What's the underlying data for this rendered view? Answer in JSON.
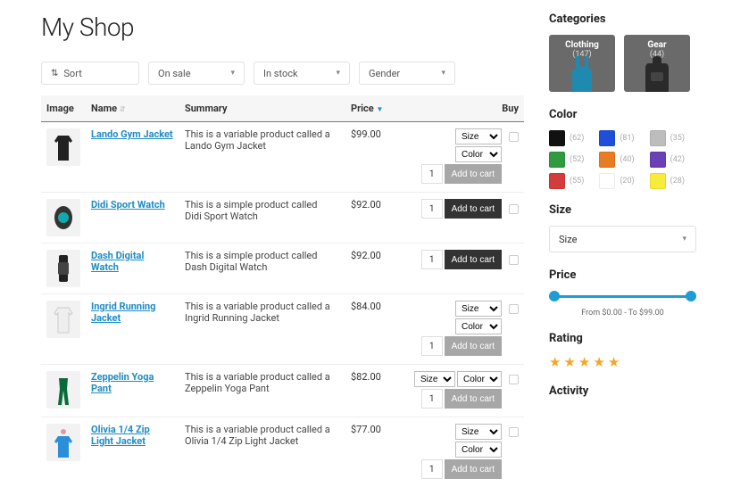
{
  "page": {
    "title": "My Shop"
  },
  "filters": {
    "sort": "Sort",
    "options": [
      "On sale",
      "In stock",
      "Gender"
    ]
  },
  "columns": {
    "image": "Image",
    "name": "Name",
    "summary": "Summary",
    "price": "Price",
    "buy": "Buy"
  },
  "buy": {
    "size": "Size",
    "color": "Color",
    "qty": "1",
    "add": "Add to cart"
  },
  "products": [
    {
      "name": "Lando Gym Jacket",
      "summary": "This is a variable product called a Lando Gym Jacket",
      "price": "$99.00",
      "variable": true,
      "opts": "stack"
    },
    {
      "name": "Didi Sport Watch",
      "summary": "This is a simple product called Didi Sport Watch",
      "price": "$92.00",
      "variable": false
    },
    {
      "name": "Dash Digital Watch",
      "summary": "This is a simple product called Dash Digital Watch",
      "price": "$92.00",
      "variable": false
    },
    {
      "name": "Ingrid Running Jacket",
      "summary": "This is a variable product called a Ingrid Running Jacket",
      "price": "$84.00",
      "variable": true,
      "opts": "stack"
    },
    {
      "name": "Zeppelin Yoga Pant",
      "summary": "This is a variable product called a Zeppelin Yoga Pant",
      "price": "$82.00",
      "variable": true,
      "opts": "row"
    },
    {
      "name": "Olivia 1/4 Zip Light Jacket",
      "summary": "This is a variable product called a Olivia 1/4 Zip Light Jacket",
      "price": "$77.00",
      "variable": true,
      "opts": "stack"
    }
  ],
  "sidebar": {
    "categories_h": "Categories",
    "categories": [
      {
        "label": "Clothing",
        "count": "(147)"
      },
      {
        "label": "Gear",
        "count": "(44)"
      }
    ],
    "color_h": "Color",
    "colors": [
      {
        "hex": "#111111",
        "count": "(62)"
      },
      {
        "hex": "#1f4fd8",
        "count": "(81)"
      },
      {
        "hex": "#bdbdbd",
        "count": "(35)"
      },
      {
        "hex": "#2e9b3e",
        "count": "(52)"
      },
      {
        "hex": "#e77c22",
        "count": "(40)"
      },
      {
        "hex": "#6b3fb5",
        "count": "(42)"
      },
      {
        "hex": "#d43c3c",
        "count": "(55)"
      },
      {
        "hex": "#ffffff",
        "count": "(20)"
      },
      {
        "hex": "#f7ec3a",
        "count": "(28)"
      }
    ],
    "size_h": "Size",
    "size_sel": "Size",
    "price_h": "Price",
    "price_range": "From $0.00 - To $99.00",
    "rating_h": "Rating",
    "activity_h": "Activity"
  }
}
